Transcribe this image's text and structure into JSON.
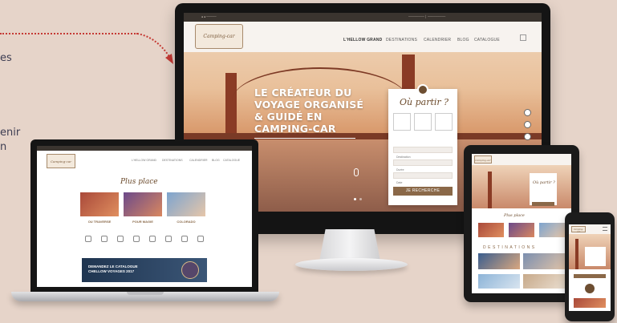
{
  "intro_text": {
    "line1": "es",
    "line2": "enir",
    "line3": "n"
  },
  "annotation": {
    "arrow_color": "#c53a34"
  },
  "website": {
    "logo_text": "Camping-car",
    "nav_items": [
      "L'HELLOW GRAND",
      "DESTINATIONS",
      "CALENDRIER",
      "BLOG",
      "CATALOGUE"
    ],
    "hero_title_lines": [
      "LE CRÉATEUR DU",
      "VOYAGE ORGANISÉ",
      "& GUIDÉ EN",
      "CAMPING-CAR"
    ],
    "search_title": "Où partir ?",
    "search_fields": [
      "Destination",
      "Durée",
      "Date"
    ],
    "search_button": "JE RECHERCHE",
    "favorites_title": "Plus place",
    "tiles": [
      "OU TRAVERSE",
      "POUR MAGIE",
      "COLORADO"
    ],
    "banner_text": "DEMANDEZ LE CATALOGUE\nCHELLOW VOYAGES 2017",
    "tablet_strip": "DESTINATIONS",
    "colors": {
      "brand_brown": "#8a6848",
      "dark_nav": "#3a342f",
      "banner_blue": "#1f3550"
    }
  }
}
